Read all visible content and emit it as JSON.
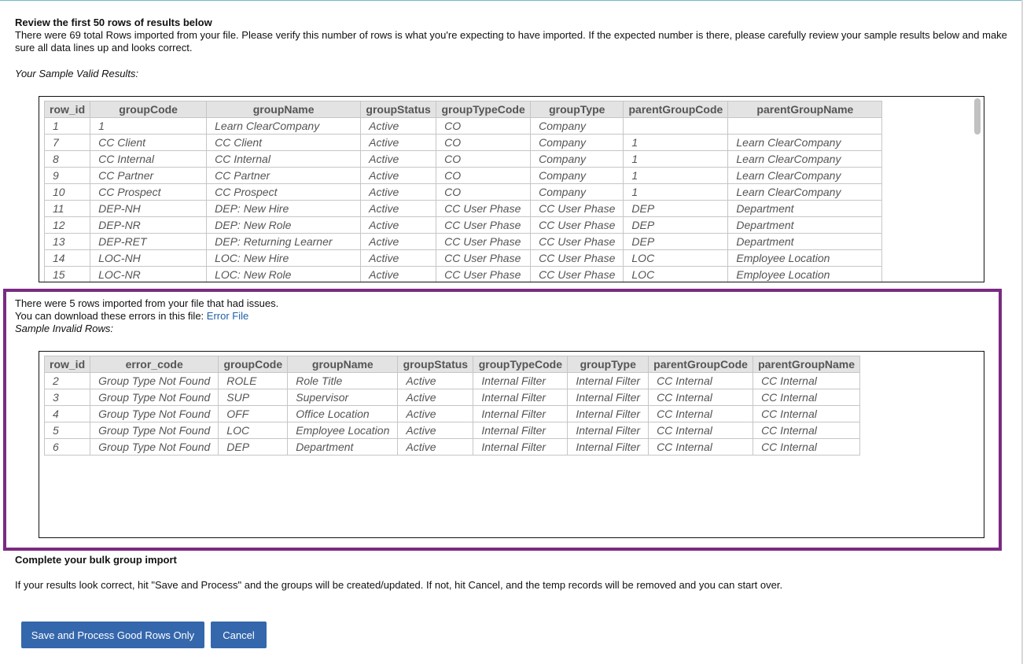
{
  "intro": {
    "heading": "Review the first 50 rows of results below",
    "body": "There were 69 total Rows imported from your file. Please verify this number of rows is what you're expecting to have imported. If the expected number is there, please carefully review your sample results below and make sure all data lines up and looks correct."
  },
  "valid": {
    "label": "Your Sample Valid Results:",
    "columns": [
      "row_id",
      "groupCode",
      "groupName",
      "groupStatus",
      "groupTypeCode",
      "groupType",
      "parentGroupCode",
      "parentGroupName"
    ],
    "rows": [
      [
        "1",
        "1",
        "Learn ClearCompany",
        "Active",
        "CO",
        "Company",
        "",
        ""
      ],
      [
        "7",
        "CC Client",
        "CC Client",
        "Active",
        "CO",
        "Company",
        "1",
        "Learn ClearCompany"
      ],
      [
        "8",
        "CC Internal",
        "CC Internal",
        "Active",
        "CO",
        "Company",
        "1",
        "Learn ClearCompany"
      ],
      [
        "9",
        "CC Partner",
        "CC Partner",
        "Active",
        "CO",
        "Company",
        "1",
        "Learn ClearCompany"
      ],
      [
        "10",
        "CC Prospect",
        "CC Prospect",
        "Active",
        "CO",
        "Company",
        "1",
        "Learn ClearCompany"
      ],
      [
        "11",
        "DEP-NH",
        "DEP: New Hire",
        "Active",
        "CC User Phase",
        "CC User Phase",
        "DEP",
        "Department"
      ],
      [
        "12",
        "DEP-NR",
        "DEP: New Role",
        "Active",
        "CC User Phase",
        "CC User Phase",
        "DEP",
        "Department"
      ],
      [
        "13",
        "DEP-RET",
        "DEP: Returning Learner",
        "Active",
        "CC User Phase",
        "CC User Phase",
        "DEP",
        "Department"
      ],
      [
        "14",
        "LOC-NH",
        "LOC: New Hire",
        "Active",
        "CC User Phase",
        "CC User Phase",
        "LOC",
        "Employee Location"
      ],
      [
        "15",
        "LOC-NR",
        "LOC: New Role",
        "Active",
        "CC User Phase",
        "CC User Phase",
        "LOC",
        "Employee Location"
      ]
    ]
  },
  "issues": {
    "line1": "There were 5 rows imported from your file that had issues.",
    "line2": "You can download these errors in this file: ",
    "link": "Error File",
    "sub": "Sample Invalid Rows:"
  },
  "invalid": {
    "columns": [
      "row_id",
      "error_code",
      "groupCode",
      "groupName",
      "groupStatus",
      "groupTypeCode",
      "groupType",
      "parentGroupCode",
      "parentGroupName"
    ],
    "rows": [
      [
        "2",
        "Group Type Not Found",
        "ROLE",
        "Role Title",
        "Active",
        "Internal Filter",
        "Internal Filter",
        "CC Internal",
        "CC Internal"
      ],
      [
        "3",
        "Group Type Not Found",
        "SUP",
        "Supervisor",
        "Active",
        "Internal Filter",
        "Internal Filter",
        "CC Internal",
        "CC Internal"
      ],
      [
        "4",
        "Group Type Not Found",
        "OFF",
        "Office Location",
        "Active",
        "Internal Filter",
        "Internal Filter",
        "CC Internal",
        "CC Internal"
      ],
      [
        "5",
        "Group Type Not Found",
        "LOC",
        "Employee Location",
        "Active",
        "Internal Filter",
        "Internal Filter",
        "CC Internal",
        "CC Internal"
      ],
      [
        "6",
        "Group Type Not Found",
        "DEP",
        "Department",
        "Active",
        "Internal Filter",
        "Internal Filter",
        "CC Internal",
        "CC Internal"
      ]
    ]
  },
  "complete": {
    "heading": "Complete your bulk group import",
    "body": "If your results look correct, hit \"Save and Process\" and the groups will be created/updated. If not, hit Cancel, and the temp records will be removed and you can start over."
  },
  "buttons": {
    "save": "Save and Process Good Rows Only",
    "cancel": "Cancel"
  },
  "colors": {
    "highlight_border": "#7a2a82",
    "button": "#3567ac",
    "link": "#1f5fa8"
  }
}
